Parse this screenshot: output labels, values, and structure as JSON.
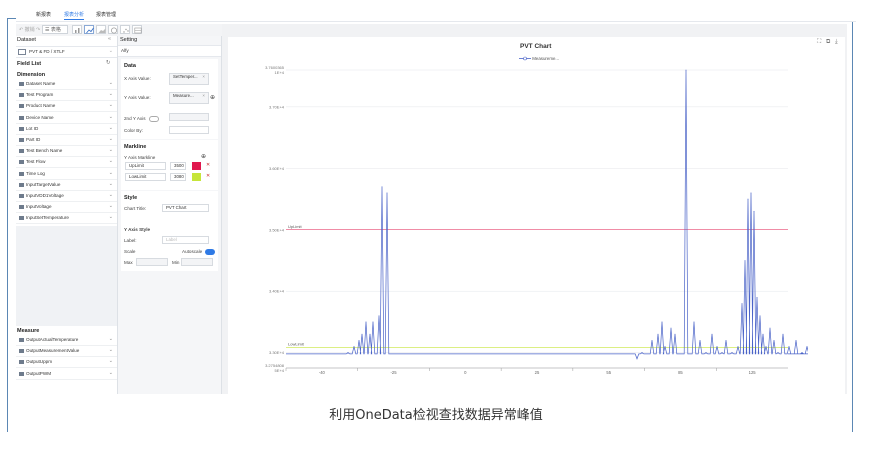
{
  "top_nav": {
    "tabs": [
      "新报表",
      "报表分析",
      "报表管理"
    ],
    "active_tab": 1
  },
  "toolbar": {
    "undo_label": "↶ 撤销",
    "redo_label": "↷",
    "view_label": "☰ 表格"
  },
  "dataset": {
    "title": "Dataset",
    "selected": "PVT & FD / XTLF",
    "field_list_title": "Field List",
    "dimension_title": "Dimension",
    "dimensions": [
      "Dataset Name",
      "Test Program",
      "Product Name",
      "Device Name",
      "Lot ID",
      "Part ID",
      "Test Bench Name",
      "Test Flow",
      "Time Log",
      "InputTargetValue",
      "InputVDD1Voltage",
      "InputVoltage",
      "InputSetTemperature"
    ],
    "measure_title": "Measure",
    "measures": [
      "OutputActualTemperature",
      "OutputMeasurementValue",
      "OutputUppm",
      "OutputPWM"
    ]
  },
  "setting": {
    "title": "Setting",
    "sub": "Alfy",
    "data_title": "Data",
    "x_axis_label": "X Axis Value:",
    "x_axis_value": "SetTemper...",
    "y_axis_label": "Y Axis Value:",
    "y_axis_value": "Measure...",
    "second_y_label": "2nd Y Axis",
    "color_by_label": "Color By:",
    "markline_title": "Markline",
    "y_axis_markline_label": "Y Axis Markline",
    "marklines": [
      {
        "name": "UpLimit",
        "value": "3500",
        "color": "#e0184e"
      },
      {
        "name": "LowLimit",
        "value": "3080",
        "color": "#c6e53a"
      }
    ],
    "style_title": "Style",
    "chart_title_label": "Chart Title:",
    "chart_title_value": "PVT Chart",
    "y_axis_style_title": "Y Axis Style",
    "label_label": "Label:",
    "label_placeholder": "Label",
    "scale_label": "Scale",
    "autoscale_label": "Autoscale",
    "max_label": "Max",
    "min_label": "Min"
  },
  "chart_data": {
    "type": "line",
    "title": "PVT Chart",
    "legend": [
      "Measureme..."
    ],
    "legend_position": "top-center",
    "y_ticks": [
      "3.7600365\n1E+4",
      "3.70E+4",
      "3.60E+4",
      "3.50E+4",
      "3.40E+4",
      "3.30E+4",
      "3.2754808\n5E+4"
    ],
    "y_tick_values": [
      3.76,
      3.7,
      3.6,
      3.5,
      3.4,
      3.3,
      3.275
    ],
    "x_ticks": [
      "-40",
      "-25",
      "0",
      "25",
      "55",
      "85",
      "125"
    ],
    "ylim": [
      3.275,
      3.76
    ],
    "y_unit_scale": "E+4",
    "marklines": [
      {
        "name": "UpLimit",
        "value": 3.5,
        "color": "#e0184e"
      },
      {
        "name": "LowLimit",
        "value": 3.308,
        "color": "#c6e53a"
      }
    ],
    "series": [
      {
        "name": "Measureme...",
        "color": "#4a63c8",
        "spikes": [
          [
            62,
            3.3
          ],
          [
            68,
            3.31
          ],
          [
            73,
            3.32
          ],
          [
            76,
            3.33
          ],
          [
            80,
            3.35
          ],
          [
            84,
            3.33
          ],
          [
            87,
            3.35
          ],
          [
            93,
            3.36
          ],
          [
            96,
            3.57
          ],
          [
            101,
            3.56
          ],
          [
            351,
            3.29
          ],
          [
            356,
            3.3
          ],
          [
            366,
            3.32
          ],
          [
            372,
            3.33
          ],
          [
            376,
            3.35
          ],
          [
            379,
            3.31
          ],
          [
            385,
            3.34
          ],
          [
            389,
            3.33
          ],
          [
            400,
            3.76
          ],
          [
            408,
            3.35
          ],
          [
            414,
            3.32
          ],
          [
            420,
            3.3
          ],
          [
            426,
            3.33
          ],
          [
            431,
            3.31
          ],
          [
            436,
            3.3
          ],
          [
            440,
            3.32
          ],
          [
            446,
            3.3
          ],
          [
            452,
            3.31
          ],
          [
            456,
            3.38
          ],
          [
            459,
            3.45
          ],
          [
            462,
            3.55
          ],
          [
            465,
            3.56
          ],
          [
            468,
            3.53
          ],
          [
            471,
            3.39
          ],
          [
            474,
            3.36
          ],
          [
            477,
            3.33
          ],
          [
            480,
            3.31
          ],
          [
            484,
            3.34
          ],
          [
            488,
            3.32
          ],
          [
            492,
            3.3
          ],
          [
            497,
            3.33
          ],
          [
            503,
            3.31
          ],
          [
            510,
            3.32
          ],
          [
            516,
            3.3
          ],
          [
            521,
            3.31
          ],
          [
            531,
            3.29
          ],
          [
            546,
            3.29
          ]
        ]
      }
    ]
  },
  "caption": "利用OneData检视查找数据异常峰值"
}
